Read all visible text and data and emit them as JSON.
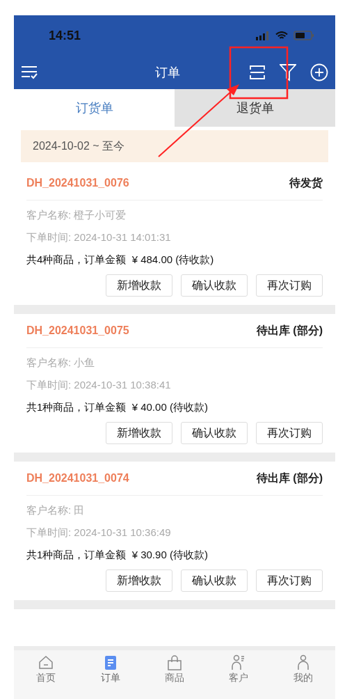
{
  "status_bar": {
    "time": "14:51"
  },
  "header": {
    "title": "订单"
  },
  "tabs": [
    {
      "label": "订货单",
      "selected": true
    },
    {
      "label": "退货单",
      "selected": false
    }
  ],
  "date_range": "2024-10-02 ~ 至今",
  "orders": [
    {
      "number": "DH_20241031_0076",
      "status": "待发货",
      "customer": "客户名称: 橙子小可爱",
      "time": "下单时间: 2024-10-31 14:01:31",
      "summary": "共4种商品，订单金额  ¥ 484.00 (待收款)",
      "actions": [
        "新增收款",
        "确认收款",
        "再次订购"
      ]
    },
    {
      "number": "DH_20241031_0075",
      "status": "待出库 (部分)",
      "customer": "客户名称: 小鱼",
      "time": "下单时间: 2024-10-31 10:38:41",
      "summary": "共1种商品，订单金额  ¥ 40.00 (待收款)",
      "actions": [
        "新增收款",
        "确认收款",
        "再次订购"
      ]
    },
    {
      "number": "DH_20241031_0074",
      "status": "待出库 (部分)",
      "customer": "客户名称: 田",
      "time": "下单时间: 2024-10-31 10:36:49",
      "summary": "共1种商品，订单金额  ¥ 30.90 (待收款)",
      "actions": [
        "新增收款",
        "确认收款",
        "再次订购"
      ]
    }
  ],
  "nav": [
    {
      "label": "首页",
      "selected": false
    },
    {
      "label": "订单",
      "selected": true
    },
    {
      "label": "商品",
      "selected": false
    },
    {
      "label": "客户",
      "selected": false
    },
    {
      "label": "我的",
      "selected": false
    }
  ]
}
